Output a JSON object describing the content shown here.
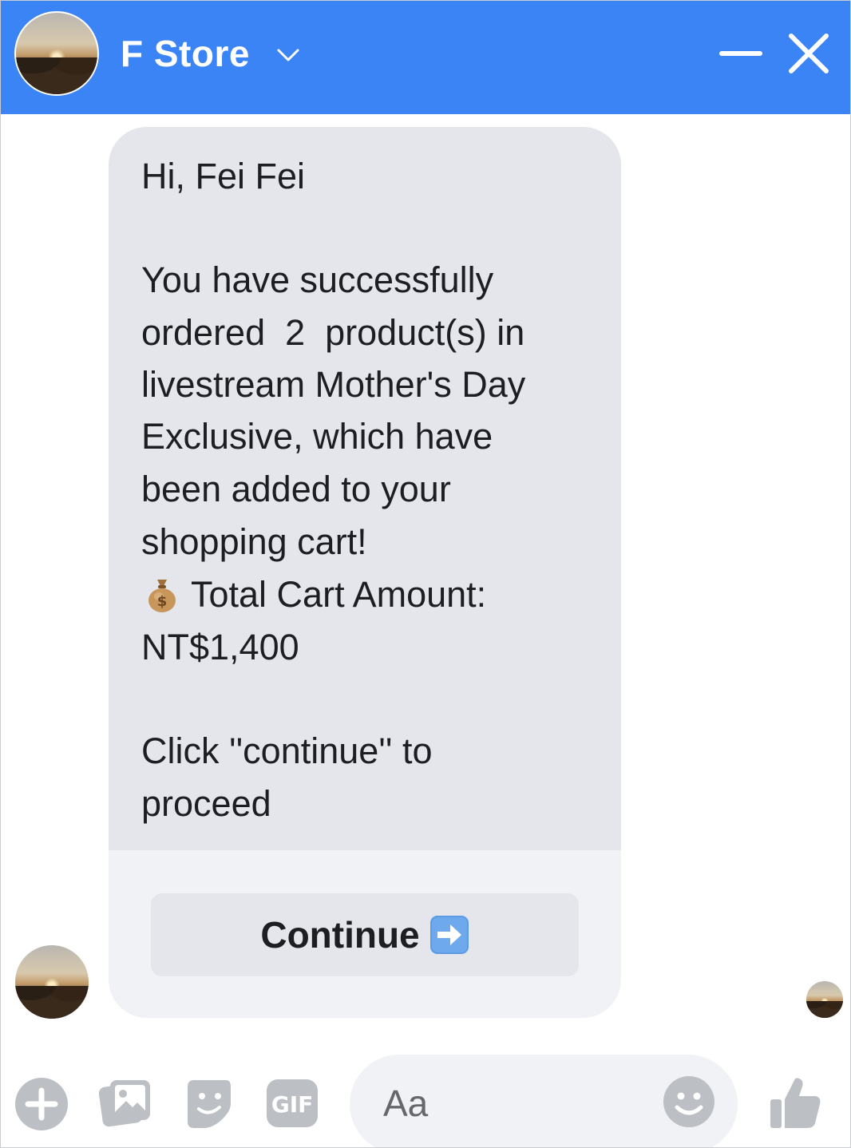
{
  "header": {
    "title": "F Store",
    "colors": {
      "bar": "#3b84f5",
      "text": "#ffffff"
    },
    "icons": [
      "chevron-down-icon",
      "minimize-icon",
      "close-icon"
    ]
  },
  "message": {
    "lines": [
      "Hi, Fei Fei",
      "You have successfully",
      "ordered  2  product(s) in",
      "livestream Mother's Day",
      "Exclusive, which have",
      "been added to your",
      "shopping cart!",
      "Total Cart Amount:",
      "NT$1,400",
      "Click ''continue'' to",
      "proceed"
    ],
    "money_icon": "money-bag-icon",
    "button_label": "Continue",
    "button_icon": "right-arrow-icon"
  },
  "composer": {
    "placeholder": "Aa",
    "gif_label": "GIF",
    "icons": [
      "plus-icon",
      "photo-icon",
      "sticker-icon",
      "gif-icon",
      "emoji-icon",
      "thumbs-up-icon"
    ]
  }
}
